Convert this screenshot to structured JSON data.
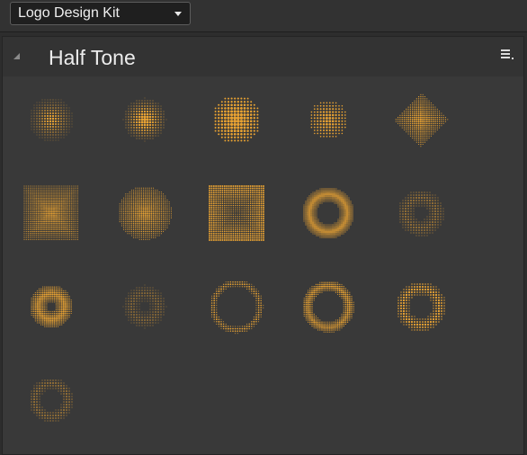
{
  "kit_selector": {
    "value": "Logo Design Kit"
  },
  "panel": {
    "title": "Half Tone"
  },
  "accent_color": "#e8a233",
  "items": [
    {
      "name": "halftone-soft-dot"
    },
    {
      "name": "halftone-small-dot"
    },
    {
      "name": "halftone-large-grid"
    },
    {
      "name": "halftone-faint-grid"
    },
    {
      "name": "halftone-diamond"
    },
    {
      "name": "halftone-rounded-square"
    },
    {
      "name": "halftone-soft-circle"
    },
    {
      "name": "halftone-square-burst"
    },
    {
      "name": "halftone-thick-ring"
    },
    {
      "name": "halftone-faint-ring"
    },
    {
      "name": "halftone-dark-center"
    },
    {
      "name": "halftone-faint-dark-center"
    },
    {
      "name": "halftone-thin-ring"
    },
    {
      "name": "halftone-bold-ring"
    },
    {
      "name": "halftone-dotted-ring"
    },
    {
      "name": "halftone-scatter-ring"
    }
  ]
}
